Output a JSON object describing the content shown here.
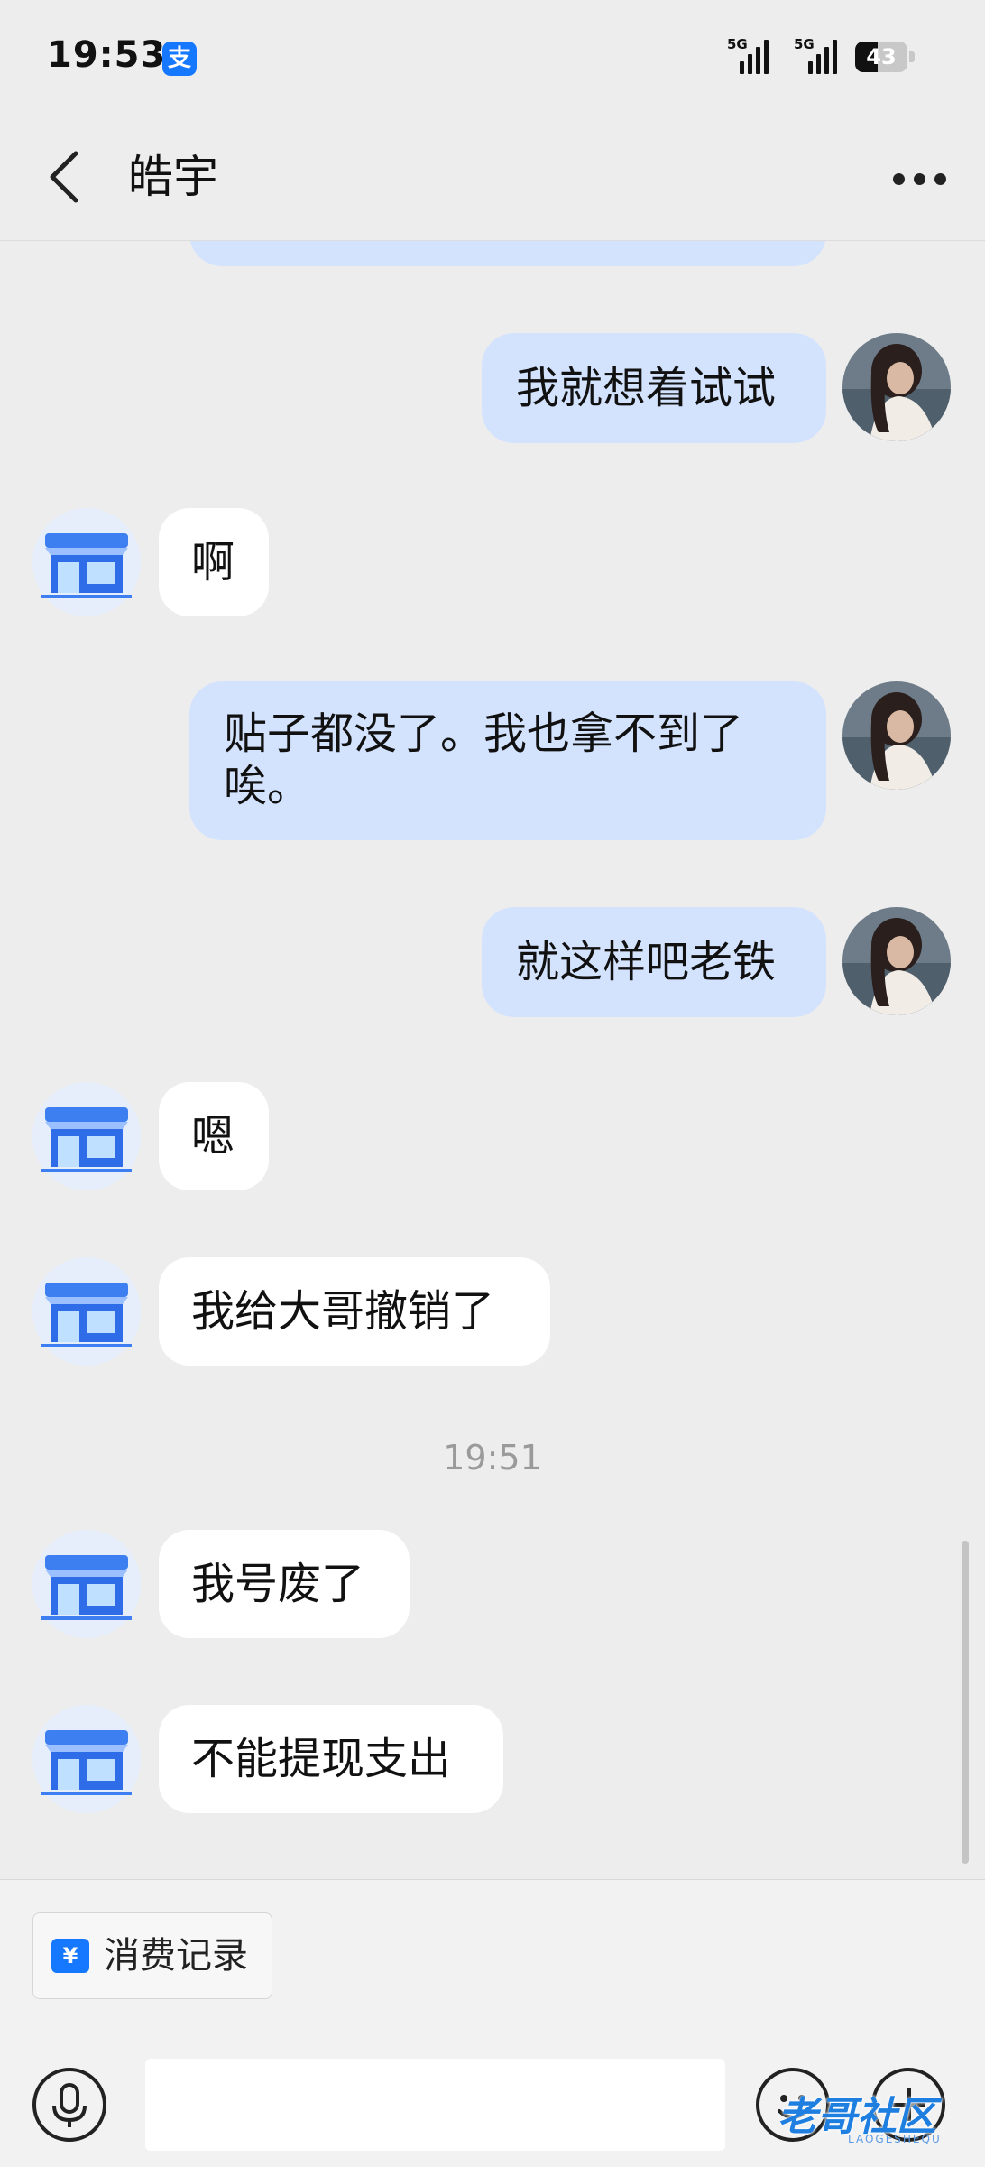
{
  "status_bar": {
    "time": "19:53",
    "app_badge": "支",
    "signal1_label": "5G",
    "signal2_label": "5G",
    "battery": "43",
    "battery_level": 0.43
  },
  "header": {
    "title": "皓宇"
  },
  "messages": [
    {
      "sender": "me",
      "text": "我就想着试试"
    },
    {
      "sender": "them",
      "text": "啊"
    },
    {
      "sender": "me",
      "text": "贴子都没了。我也拿不到了唉。"
    },
    {
      "sender": "me",
      "text": "就这样吧老铁"
    },
    {
      "sender": "them",
      "text": "嗯"
    },
    {
      "sender": "them",
      "text": "我给大哥撤销了"
    },
    {
      "sender": "them",
      "text": "我号废了"
    },
    {
      "sender": "them",
      "text": "不能提现支出"
    }
  ],
  "timestamp": "19:51",
  "bottom": {
    "record_icon": "¥",
    "record_label": "消费记录",
    "input_placeholder": ""
  },
  "watermark": {
    "text": "老哥社区",
    "sub": "LAOGESHEQU"
  },
  "colors": {
    "my_bubble": "#d4e3fd",
    "their_bubble": "#ffffff",
    "background": "#ededed",
    "accent": "#1677ff"
  }
}
